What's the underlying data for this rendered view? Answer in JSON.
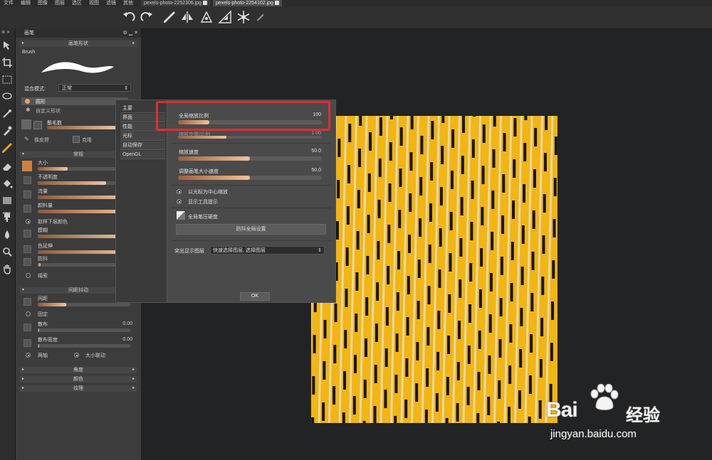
{
  "menu": [
    "文件",
    "编辑",
    "图像",
    "图层",
    "选区",
    "视图",
    "滤镜",
    "其他"
  ],
  "tabs": [
    "pexels-photo-2252306.jpg",
    "pexels-photo-2254102.jpg"
  ],
  "brush_panel": {
    "title": "画笔",
    "shape_section": "画笔形状",
    "brush_label": "Brush",
    "blend_label": "混合模式:",
    "blend_value": "正常",
    "shape_round": "圆形",
    "shape_custom": "自定义形状",
    "bristles": "鬃毛数",
    "eraser": "橡皮擦",
    "smudge": "克隆",
    "general_section": "常规",
    "size": "大小",
    "opacity": "不透明度",
    "flow": "流量",
    "paint_amount": "颜料量",
    "sample_below": "取样下层颜色",
    "blur": "模糊",
    "color_stretch": "色延伸",
    "jitter": "防抖",
    "rope": "绳索",
    "spacing_section": "间距抖动",
    "spacing": "间距",
    "fixed": "固定",
    "scatter": "散布",
    "scatter_value": "0.00",
    "scatter_density": "散布密度",
    "scatter_density_value": "0.00",
    "both_axes": "两轴",
    "size_link": "大小联动",
    "angle_section": "角度",
    "color_section": "颜色",
    "texture_section": "纹理"
  },
  "dialog": {
    "nav": [
      "主要",
      "界面",
      "性能",
      "光标",
      "自动保存",
      "OpenGL"
    ],
    "global_scale_label": "全局缩放比例",
    "global_scale_value": "100",
    "global_scale_fraction": 0.22,
    "hidden_label": "缩放步骤/比例",
    "hidden_value": "1.00",
    "zoom_speed_label": "缩放速度",
    "zoom_speed_value": "50.0",
    "zoom_speed_fraction": 0.5,
    "resize_speed_label": "调整画笔大小速度",
    "resize_speed_value": "50.0",
    "resize_speed_fraction": 0.5,
    "radio_cursor_center": "以光标为中心缩放",
    "radio_show_hint": "显示工具提示",
    "pressure_label": "全局笔压硬度",
    "jitter_button": "防抖全局设置",
    "highlight_layer_label": "突出显示图层",
    "highlight_layer_value": "快速选择图层, 选择图层",
    "ok": "OK"
  },
  "watermark": {
    "brand": "Bai",
    "brand2": "经验",
    "url": "jingyan.baidu.com"
  },
  "colors": {
    "accent_red": "#e52c2c",
    "canvas_yellow": "#f2b511"
  }
}
